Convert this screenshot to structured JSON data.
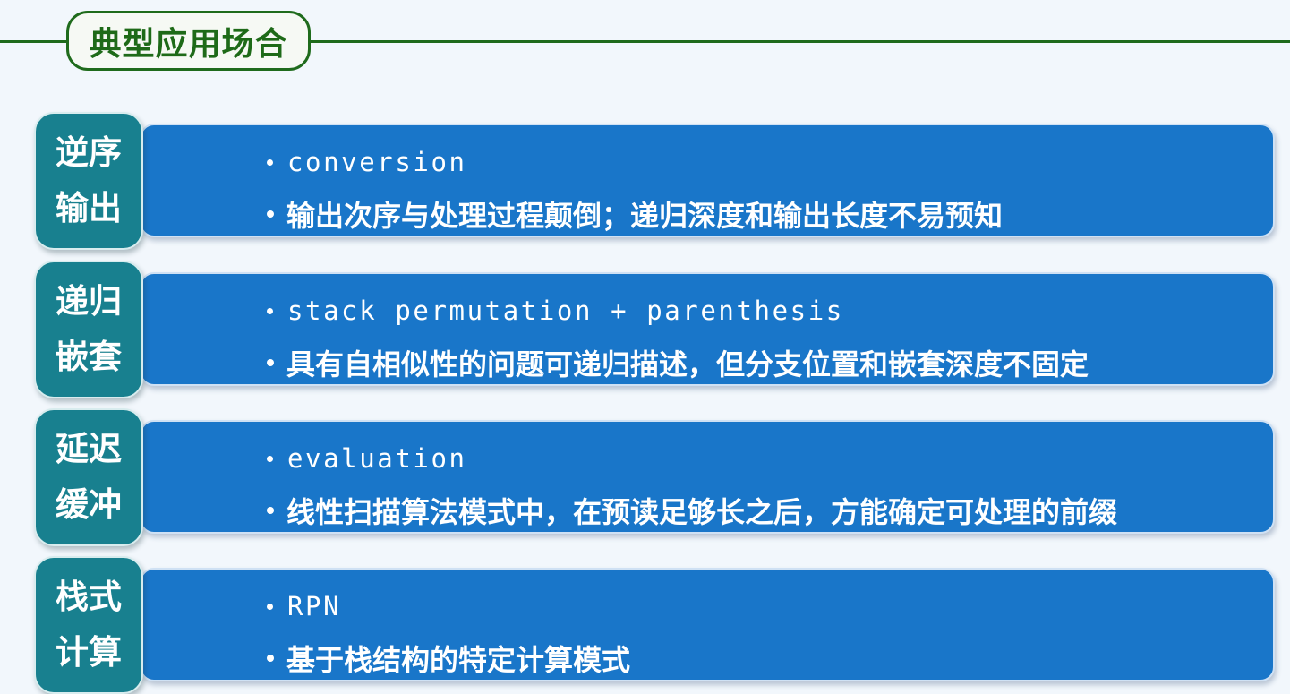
{
  "header": {
    "title": "典型应用场合"
  },
  "rows": [
    {
      "tag_line1": "逆序",
      "tag_line2": "输出",
      "keyword": "conversion",
      "description": "输出次序与处理过程颠倒；递归深度和输出长度不易预知"
    },
    {
      "tag_line1": "递归",
      "tag_line2": "嵌套",
      "keyword": "stack permutation + parenthesis",
      "description": "具有自相似性的问题可递归描述，但分支位置和嵌套深度不固定"
    },
    {
      "tag_line1": "延迟",
      "tag_line2": "缓冲",
      "keyword": "evaluation",
      "description": "线性扫描算法模式中，在预读足够长之后，方能确定可处理的前缀"
    },
    {
      "tag_line1": "栈式",
      "tag_line2": "计算",
      "keyword": "RPN",
      "description": "基于栈结构的特定计算模式"
    }
  ],
  "colors": {
    "title_green": "#1e6a18",
    "tag_teal": "#18808f",
    "content_blue": "#1976c9",
    "background": "#f2f7fc"
  }
}
